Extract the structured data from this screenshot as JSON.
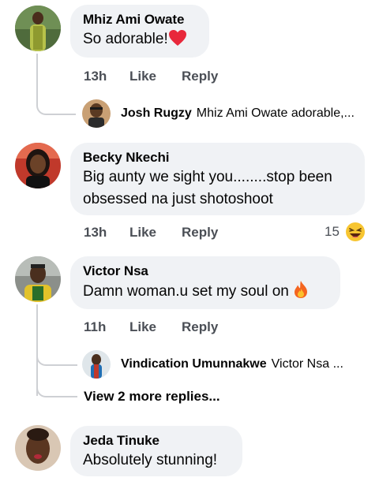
{
  "comments": [
    {
      "author": "Mhiz Ami Owate",
      "text": "So adorable!",
      "emoji_icon": "heart-emoji",
      "time": "13h",
      "like_label": "Like",
      "reply_label": "Reply"
    },
    {
      "author": "Becky Nkechi",
      "text_line1": "Big aunty we sight you........stop been",
      "text_line2": "obsessed na just shotoshoot",
      "time": "13h",
      "like_label": "Like",
      "reply_label": "Reply",
      "reaction_count": "15",
      "reaction_icon": "laughing-emoji"
    },
    {
      "author": "Victor Nsa",
      "text": "Damn woman.u set my soul on",
      "emoji_icon": "fire-emoji",
      "time": "11h",
      "like_label": "Like",
      "reply_label": "Reply"
    },
    {
      "author": "Jeda Tinuke",
      "text": "Absolutely stunning!"
    }
  ],
  "replies": [
    {
      "author": "Josh Rugzy",
      "preview": "Mhiz Ami Owate adorable,..."
    },
    {
      "author": "Vindication Umunnakwe",
      "preview": "Victor Nsa ..."
    }
  ],
  "view_more_label": "View 2 more replies...",
  "colors": {
    "bubble": "#f0f2f5",
    "action_text": "#4b4f56",
    "thread_line": "#ced0d4"
  }
}
